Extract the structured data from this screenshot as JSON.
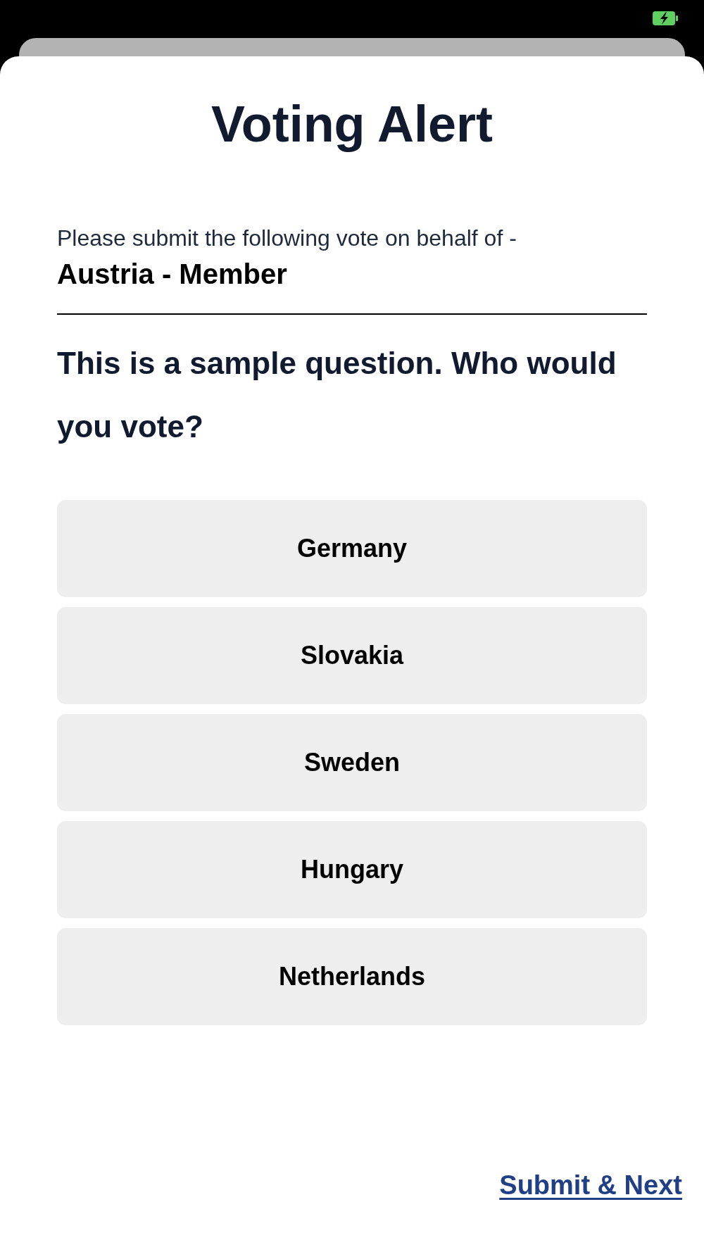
{
  "alert": {
    "title": "Voting Alert"
  },
  "prompt": "Please submit the following vote on behalf of -",
  "voter": "Austria - Member",
  "question": "This is a sample question. Who would you vote?",
  "options": [
    {
      "label": "Germany",
      "selected": false
    },
    {
      "label": "Slovakia",
      "selected": false
    },
    {
      "label": "Sweden",
      "selected": false
    },
    {
      "label": "Hungary",
      "selected": false
    },
    {
      "label": "Netherlands",
      "selected": false
    }
  ],
  "submit_link": "Submit & Next"
}
